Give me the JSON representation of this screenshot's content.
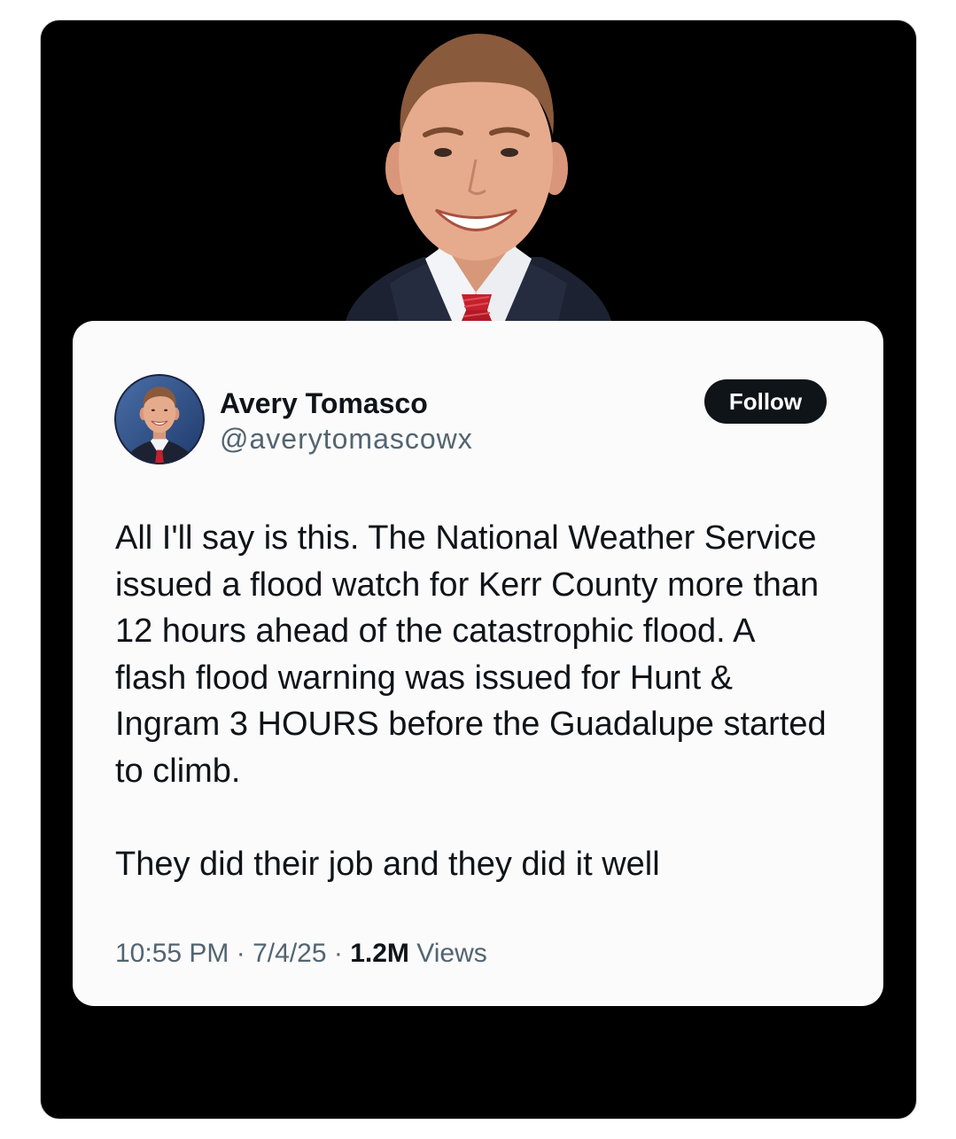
{
  "post": {
    "author": {
      "name": "Avery Tomasco",
      "handle": "@averytomascowx"
    },
    "follow_label": "Follow",
    "text": [
      [
        "All I'll say is this. The National Weather Service",
        "issued a flood watch for Kerr County more than",
        "12 hours ahead of the catastrophic flood. A",
        "flash flood warning was issued for Hunt &",
        "Ingram 3 HOURS before the Guadalupe started",
        "to climb."
      ],
      [
        "They did their job and they did it well"
      ]
    ],
    "meta": {
      "time": "10:55 PM",
      "separator": "·",
      "date": "7/4/25",
      "views_count": "1.2M",
      "views_label": "Views"
    }
  },
  "colors": {
    "frame_background": "#000000",
    "card_background": "#fbfbfb",
    "primary_text": "#0f1419",
    "secondary_text": "#536471",
    "follow_button_background": "#0f1419",
    "follow_button_text": "#ffffff",
    "tie_red": "#c4202e",
    "suit_navy": "#1d2232"
  },
  "icons": {
    "hero_image": "author-portrait-photo",
    "avatar_image": "author-avatar-photo"
  }
}
